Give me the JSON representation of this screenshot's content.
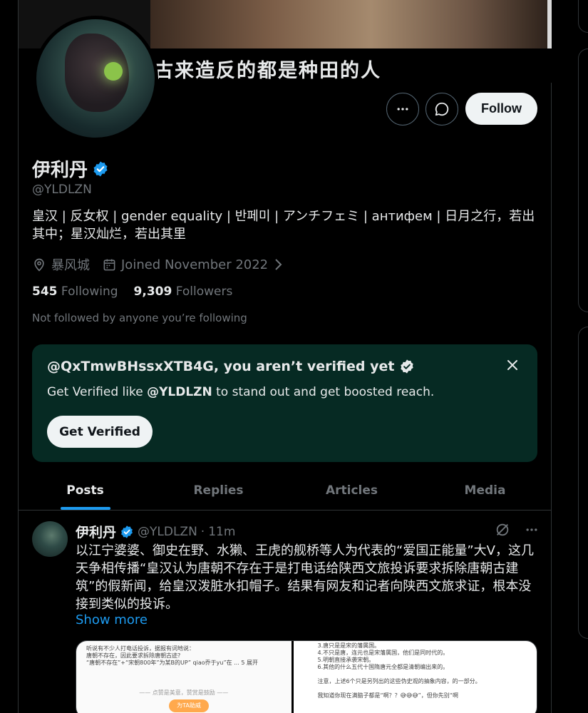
{
  "banner": {
    "caption": "古来造反的都是种田的人"
  },
  "actions": {
    "follow_label": "Follow"
  },
  "profile": {
    "display_name": "伊利丹",
    "handle": "@YLDLZN",
    "bio": "皇汉 | 反女权 | gender equality | 반페미 | アンチフェミ | антифем | 日月之行，若出其中；星汉灿烂，若出其里",
    "location": "暴风城",
    "joined": "Joined November 2022",
    "following_count": "545",
    "following_label": "Following",
    "followers_count": "9,309",
    "followers_label": "Followers",
    "not_followed": "Not followed by anyone you’re following"
  },
  "verify_card": {
    "title": "@QxTmwBHssxXTB4G, you aren’t verified yet",
    "text_before": "Get Verified like ",
    "text_handle": "@YLDLZN",
    "text_after": " to stand out and get boosted reach.",
    "button": "Get Verified"
  },
  "tabs": [
    "Posts",
    "Replies",
    "Articles",
    "Media"
  ],
  "post": {
    "name": "伊利丹",
    "handle": "@YLDLZN",
    "separator": "·",
    "time": "11m",
    "body": "以江宁婆婆、御史在野、水獭、王虎的舰桥等人为代表的“爱国正能量”大V，这几天争相传播“皇汉认为唐朝不存在于是打电话给陕西文旅投诉要求拆除唐朝古建筑”的假新闻，给皇汉泼脏水扣帽子。结果有网友和记者向陕西文旅求证，根本没接到类似的投诉。",
    "show_more": "Show more",
    "media_left": [
      "听说有不少人打电话投诉，据报有词地说：",
      "唐朝不存在，因此要求拆除唐朝古迹?",
      "“唐朝不存在”+“宋朝800年”为某B的UP” qiao乔于yu”在 ... 5 展开",
      "",
      "—— 点赞是美意，赞赏是鼓励 ——"
    ],
    "media_left_button": "为TA助威",
    "media_right": [
      "3.唐只是是宋的藩属国。",
      "4.不只是唐，连元也是宋藩属国，他们是同时代的。",
      "5.明朝直接承袭宋朝。",
      "6.其他的什么五代十国隋唐元全都是清朝编出来的。",
      "",
      "注意，上述6个只是另列出的这些伪史观的抽象内容，的一部分。",
      "",
      "我知道你现在满脑子都是“啊？？😅😅😅”，但你先别“啊"
    ]
  },
  "colors": {
    "accent": "#1d9bf0",
    "card_bg": "#062a23",
    "muted": "#71767b"
  }
}
